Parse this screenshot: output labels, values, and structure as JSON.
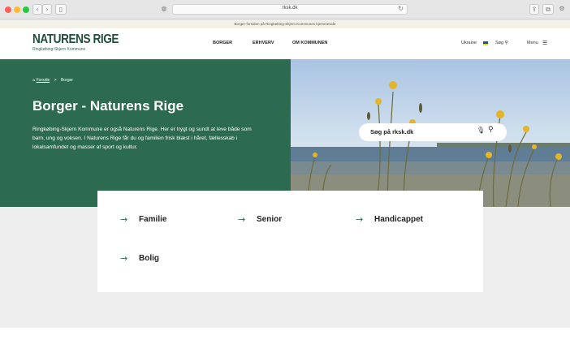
{
  "browser": {
    "url": "rksk.dk",
    "back_icon": "chevron-left-icon",
    "forward_icon": "chevron-right-icon"
  },
  "announcement": "Borger-forsiden på Ringkøbing-Skjern Kommunes hjemmeside",
  "header": {
    "logo_title": "NATURENS RIGE",
    "logo_subtitle": "Ringkøbing-Skjern Kommune",
    "nav": [
      "BORGER",
      "ERHVERV",
      "OM KOMMUNEN"
    ],
    "ukraine_label": "Ukraine",
    "search_label": "Søg",
    "menu_label": "Menu"
  },
  "hero": {
    "breadcrumb_home": "Forside",
    "breadcrumb_sep": ">",
    "breadcrumb_current": "Borger",
    "title": "Borger - Naturens Rige",
    "text": "Ringkøbing-Skjern Kommune er også Naturens Rige. Her er trygt og sundt at leve både som barn, ung og voksen. I Naturens Rige får du og familien frisk blæst i håret, fællesskab i lokalsamfundet og masser af sport og kultur.",
    "search_placeholder": "Søg på rksk.dk"
  },
  "cards": [
    {
      "label": "Familie"
    },
    {
      "label": "Senior"
    },
    {
      "label": "Handicappet"
    },
    {
      "label": "Bolig"
    }
  ],
  "colors": {
    "brand_green": "#2c6b4f",
    "logo_green": "#1f4d3b"
  }
}
